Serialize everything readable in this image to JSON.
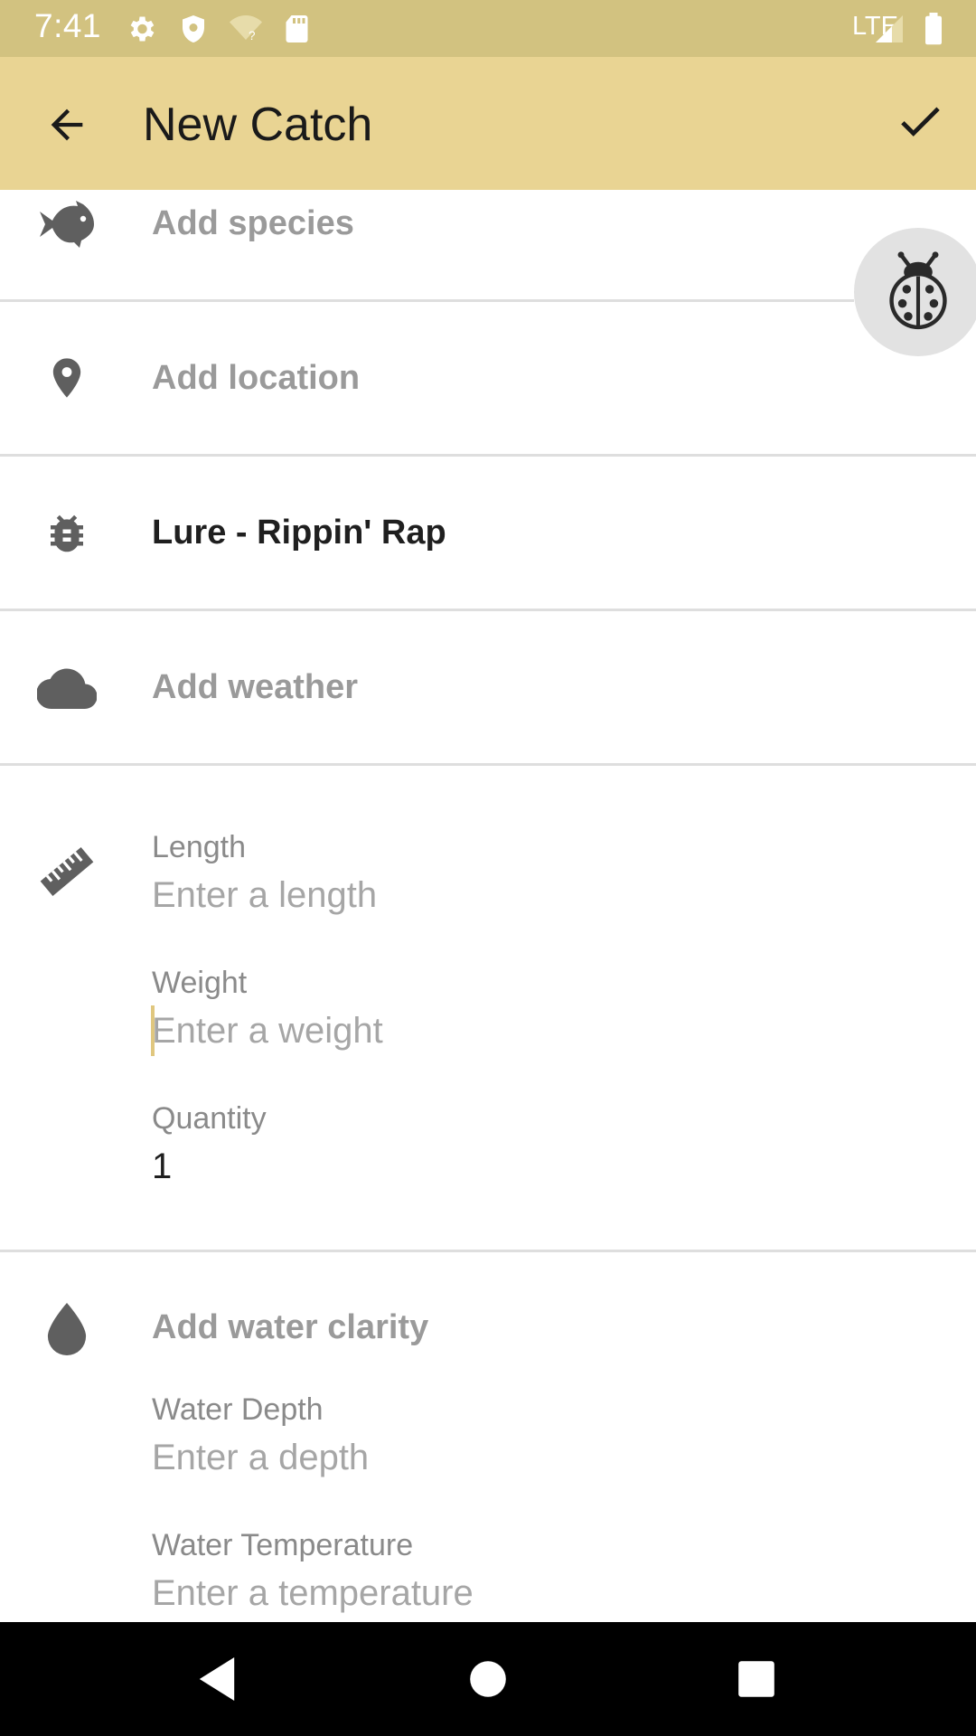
{
  "status_bar": {
    "time": "7:41",
    "network_label": "LTE",
    "icons": [
      "gear-icon",
      "shield-icon",
      "wifi-question-icon",
      "sd-card-icon",
      "signal-icon",
      "battery-icon"
    ]
  },
  "app_bar": {
    "title": "New Catch",
    "back_icon": "arrow-back-icon",
    "save_icon": "check-icon"
  },
  "rows": {
    "species": {
      "text": "Add species",
      "icon": "fish-icon"
    },
    "location": {
      "text": "Add location",
      "icon": "location-pin-icon"
    },
    "bait": {
      "text": "Lure - Rippin' Rap",
      "icon": "bug-icon"
    },
    "weather": {
      "text": "Add weather",
      "icon": "cloud-icon"
    },
    "water_clarity": {
      "text": "Add water clarity",
      "icon": "water-drop-icon"
    }
  },
  "fields": {
    "length": {
      "label": "Length",
      "placeholder": "Enter a length"
    },
    "weight": {
      "label": "Weight",
      "placeholder": "Enter a weight"
    },
    "quantity": {
      "label": "Quantity",
      "value": "1"
    },
    "water_depth": {
      "label": "Water Depth",
      "placeholder": "Enter a depth"
    },
    "water_temperature": {
      "label": "Water Temperature",
      "placeholder": "Enter a temperature"
    }
  },
  "fab": {
    "icon": "ladybug-icon"
  },
  "nav_bar": {
    "icons": [
      "nav-back-icon",
      "nav-home-icon",
      "nav-recents-icon"
    ]
  },
  "colors": {
    "status_bar": "#d2c280",
    "app_bar": "#e9d493",
    "accent_cursor": "#e0c77f",
    "icon_gray": "#5f5f5f",
    "hint_text": "#a6a6a6",
    "divider": "#dedede"
  }
}
